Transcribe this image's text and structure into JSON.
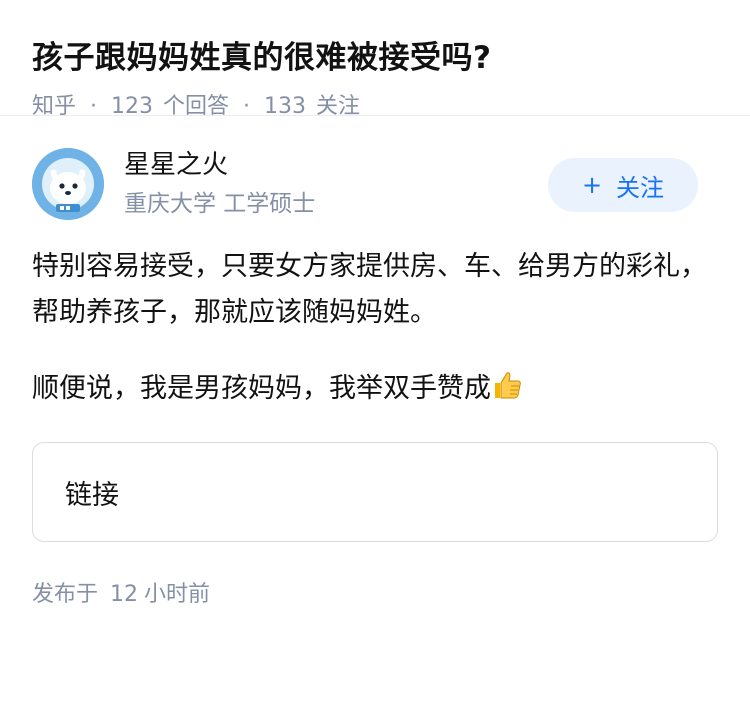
{
  "question": {
    "title": "孩子跟妈妈姓真的很难被接受吗?",
    "source": "知乎",
    "answer_count": "123",
    "answer_label": "个回答",
    "follow_count": "133",
    "follow_label": "关注",
    "separator": "·"
  },
  "author": {
    "name": "星星之火",
    "headline": "重庆大学 工学硕士",
    "follow_button_plus": "+",
    "follow_button_label": "关注",
    "avatar_icon": "astronaut-dog-avatar"
  },
  "answer": {
    "paragraph1": "特别容易接受，只要女方家提供房、车、给男方的彩礼，帮助养孩子，那就应该随妈妈姓。",
    "paragraph2": "顺便说，我是男孩妈妈，我举双手赞成",
    "emoji_icon": "thumbs-up-icon",
    "link_card_label": "链接"
  },
  "footer": {
    "publish_prefix": "发布于",
    "publish_num": "12",
    "publish_suffix": "小时前"
  },
  "colors": {
    "accent": "#1772f6",
    "follow_bg": "#e9f2fd",
    "meta_gray": "#8590a6",
    "avatar_bg": "#6fb3e6"
  }
}
